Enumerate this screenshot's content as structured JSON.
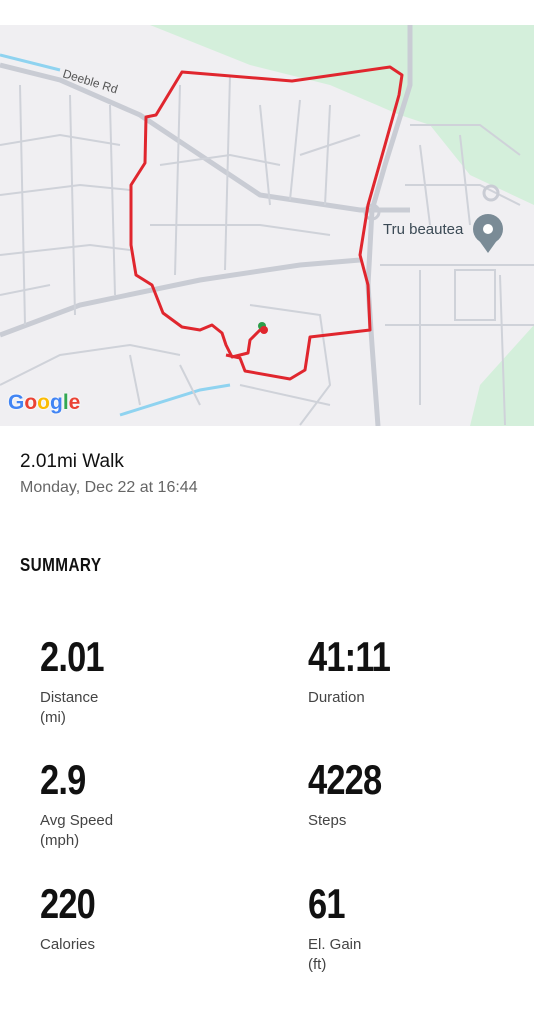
{
  "map": {
    "road_label": "Deeble Rd",
    "poi_label": "Tru beautea",
    "logo": [
      "G",
      "o",
      "o",
      "g",
      "l",
      "e"
    ],
    "logo_colors": [
      "#4285F4",
      "#EA4335",
      "#FBBC05",
      "#4285F4",
      "#34A853",
      "#EA4335"
    ],
    "route_color": "#e0262e"
  },
  "activity": {
    "title": "2.01mi Walk",
    "date": "Monday, Dec 22 at 16:44"
  },
  "summary": {
    "heading": "SUMMARY",
    "stats": [
      {
        "value": "2.01",
        "label": "Distance",
        "unit": "(mi)"
      },
      {
        "value": "41:11",
        "label": "Duration",
        "unit": ""
      },
      {
        "value": "2.9",
        "label": "Avg Speed",
        "unit": "(mph)"
      },
      {
        "value": "4228",
        "label": "Steps",
        "unit": ""
      },
      {
        "value": "220",
        "label": "Calories",
        "unit": ""
      },
      {
        "value": "61",
        "label": "El. Gain",
        "unit": "(ft)"
      }
    ]
  }
}
